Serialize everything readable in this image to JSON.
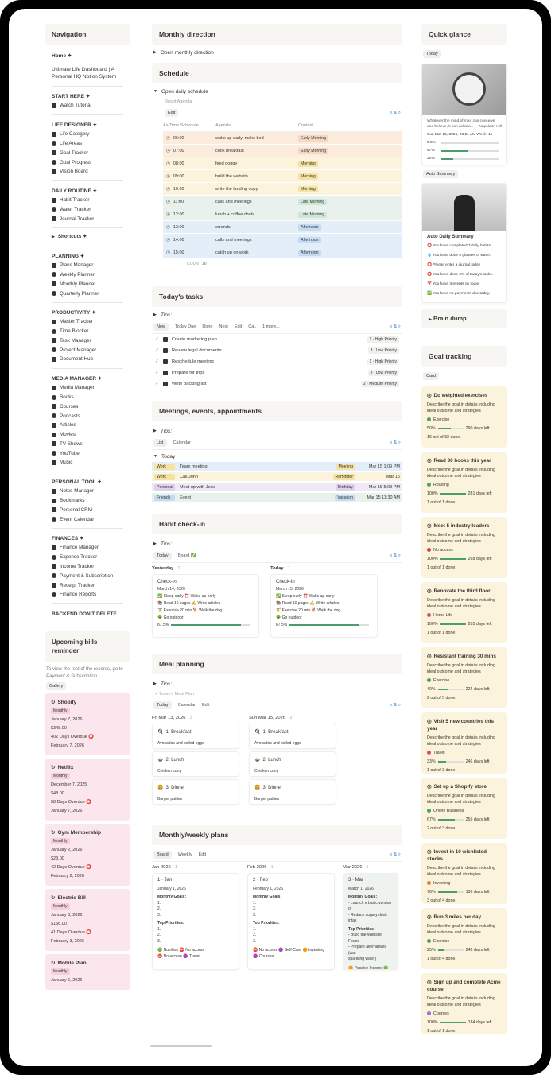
{
  "navigation": {
    "title": "Navigation",
    "home": "Home ✦",
    "home_link": "Ultimate Life Dashboard | A Personal HQ Notion System",
    "sections": [
      {
        "title": "START HERE ✦",
        "items": [
          "Watch Tutorial"
        ]
      },
      {
        "title": "LIFE DESIGNER ✦",
        "items": [
          "Life Category",
          "Life Areas",
          "Goal Tracker",
          "Goal Progress",
          "Vision Board"
        ]
      },
      {
        "title": "DAILY ROUTINE ✦",
        "items": [
          "Habit Tracker",
          "Water Tracker",
          "Journal Tracker"
        ]
      },
      {
        "title": "PLANNING ✦",
        "items": [
          "Plans Manager",
          "Weekly Planner",
          "Monthly Planner",
          "Quarterly Planner"
        ]
      },
      {
        "title": "PRODUCTIVITY ✦",
        "items": [
          "Master Tracker",
          "Time Blocker",
          "Task Manager",
          "Project Manager",
          "Document Hub"
        ]
      },
      {
        "title": "MEDIA MANAGER ✦",
        "items": [
          "Media Manager",
          "Books",
          "Courses",
          "Podcasts",
          "Articles",
          "Movies",
          "TV Shows",
          "YouTube",
          "Music"
        ]
      },
      {
        "title": "PERSONAL TOOL ✦",
        "items": [
          "Notes Manager",
          "Bookmarks",
          "Personal CRM",
          "Event Calendar"
        ]
      },
      {
        "title": "FINANCES ✦",
        "items": [
          "Finance Manager",
          "Expense Tracker",
          "Income Tracker",
          "Payment & Subscription",
          "Receipt Tracker",
          "Finance Reports"
        ]
      }
    ],
    "shortcuts": "Shortcuts ✦",
    "backend": "BACKEND DON'T DELETE"
  },
  "bills": {
    "title": "Upcoming bills reminder",
    "hint": "To view the rest of the records, go to",
    "hint_link": "Payment & Subscription",
    "view": "Gallery",
    "items": [
      {
        "name": "Shopify",
        "freq": "Monthly",
        "date": "January 7, 2026",
        "amount": "$348.00",
        "overdue": "402 Days Overdue ⭕",
        "next": "February 7, 2026"
      },
      {
        "name": "Netflix",
        "freq": "Monthly",
        "date": "December 7, 2025",
        "amount": "$48.00",
        "overdue": "58 Days Overdue ⭕",
        "next": "January 7, 2026"
      },
      {
        "name": "Gym Membership",
        "freq": "Monthly",
        "date": "January 2, 2026",
        "amount": "$23.00",
        "overdue": "42 Days Overdue ⭕",
        "next": "February 2, 2026"
      },
      {
        "name": "Electric Bill",
        "freq": "Monthly",
        "date": "January 3, 2026",
        "amount": "$156.00",
        "overdue": "41 Days Overdue ⭕",
        "next": "February 3, 2026"
      },
      {
        "name": "Mobile Plan",
        "freq": "Monthly",
        "date": "January 6, 2026",
        "amount": "",
        "overdue": "",
        "next": ""
      }
    ]
  },
  "monthly": {
    "title": "Monthly direction",
    "toggle": "Open monthly direction"
  },
  "schedule": {
    "title": "Schedule",
    "toggle": "Open daily schedule",
    "reset": "Reset Agenda",
    "edit": "Edit",
    "cols": [
      "Aa Time Schedule",
      "Agenda",
      "Context"
    ],
    "rows": [
      {
        "time": "06:00",
        "agenda": "wake up early, make bed",
        "ctx": "Early Morning",
        "bg": "#fbecdd",
        "tag": "#f3d9c4"
      },
      {
        "time": "07:00",
        "agenda": "cook breakfast",
        "ctx": "Early Morning",
        "bg": "#fbecdd",
        "tag": "#f3d9c4"
      },
      {
        "time": "08:00",
        "agenda": "feed doggy",
        "ctx": "Morning",
        "bg": "#fbf3db",
        "tag": "#f5e3a4"
      },
      {
        "time": "09:00",
        "agenda": "build the website",
        "ctx": "Morning",
        "bg": "#fbf3db",
        "tag": "#f5e3a4"
      },
      {
        "time": "10:00",
        "agenda": "write the landing copy",
        "ctx": "Morning",
        "bg": "#fbf3db",
        "tag": "#f5e3a4"
      },
      {
        "time": "11:00",
        "agenda": "calls and meetings",
        "ctx": "Late Morning",
        "bg": "#e8f1ec",
        "tag": "#cde6d6"
      },
      {
        "time": "12:00",
        "agenda": "lunch + coffee chats",
        "ctx": "Late Morning",
        "bg": "#e8f1ec",
        "tag": "#cde6d6"
      },
      {
        "time": "13:00",
        "agenda": "errands",
        "ctx": "Afternoon",
        "bg": "#e3eef9",
        "tag": "#c4dcf3"
      },
      {
        "time": "14:00",
        "agenda": "calls and meetings",
        "ctx": "Afternoon",
        "bg": "#e3eef9",
        "tag": "#c4dcf3"
      },
      {
        "time": "15:00",
        "agenda": "catch up on work",
        "ctx": "Afternoon",
        "bg": "#e3eef9",
        "tag": "#c4dcf3"
      }
    ],
    "count_label": "COUNT",
    "count": "10"
  },
  "tasks": {
    "title": "Today's tasks",
    "tips": "Tips:",
    "views": [
      "New",
      "Today Due",
      "Done",
      "Next",
      "Edit",
      "Cal.",
      "1 more..."
    ],
    "items": [
      {
        "name": "Create marketing plan",
        "pri": "1 · High Priority"
      },
      {
        "name": "Review legal documents",
        "pri": "3 · Low Priority"
      },
      {
        "name": "Reschedule meeting",
        "pri": "1 · High Priority"
      },
      {
        "name": "Prepare for trips",
        "pri": "3 · Low Priority"
      },
      {
        "name": "Write packing list",
        "pri": "2 · Medium Priority"
      }
    ]
  },
  "meetings": {
    "title": "Meetings, events, appointments",
    "tips": "Tips:",
    "views": [
      "List",
      "Calendar"
    ],
    "group": "Today",
    "items": [
      {
        "cat": "Work",
        "name": "Team meeting",
        "type": "Meeting",
        "date": "Mar 15 1:09 PM",
        "bg": "#e3eef9",
        "tag": "#f5e3a4"
      },
      {
        "cat": "Work",
        "name": "Call John",
        "type": "Reminder",
        "date": "Mar 15",
        "bg": "#fbf3db",
        "tag": "#f5e3a4"
      },
      {
        "cat": "Personal",
        "name": "Meet up with Jess",
        "type": "Birthday",
        "date": "Mar 15 5:03 PM",
        "bg": "#efe8f6",
        "tag": "#dfd0ee"
      },
      {
        "cat": "Friends",
        "name": "Event",
        "type": "Vacation",
        "date": "Mar 15 11:30 AM",
        "bg": "#e8f1ec",
        "tag": "#c4dcf3"
      }
    ]
  },
  "habit": {
    "title": "Habit check-in",
    "tips": "Tips:",
    "views": [
      "Today",
      "Board ✅"
    ],
    "groups": [
      {
        "label": "Yesterday",
        "count": "1",
        "card": "Check-in",
        "date": "March 14, 2026",
        "l1": "✅ Sleep early  ⏰ Wake up early",
        "l2": "📚 Read 10 pages  ✍ Write articles",
        "l3": "🏋 Exercise 20 min  🐕 Walk the dog",
        "l4": "🌳 Go outdoor",
        "pct": "87.5%",
        "val": 0.875
      },
      {
        "label": "Today",
        "count": "1",
        "card": "Check-in",
        "date": "March 15, 2026",
        "l1": "✅ Sleep early  ⏰ Wake up early",
        "l2": "📚 Read 10 pages  ✍ Write articles",
        "l3": "🏋 Exercise 20 min  🐕 Walk the dog",
        "l4": "🌳 Go outdoor",
        "pct": "87.5%",
        "val": 0.875
      }
    ]
  },
  "meal": {
    "title": "Meal planning",
    "tips": "Tips:",
    "new": "+ Today's Meal Plan",
    "views": [
      "Today",
      "Calendar",
      "Edit"
    ],
    "days": [
      {
        "label": "Fri Mar 13, 2026",
        "count": "3",
        "meals": [
          {
            "n": "1. Breakfast",
            "d": "Avocados and boiled eggs"
          },
          {
            "n": "2. Lunch",
            "d": "Chicken curry"
          },
          {
            "n": "3. Dinner",
            "d": "Burger patties"
          }
        ]
      },
      {
        "label": "Sun Mar 15, 2026",
        "count": "3",
        "meals": [
          {
            "n": "1. Breakfast",
            "d": "Avocados and boiled eggs"
          },
          {
            "n": "2. Lunch",
            "d": "Chicken curry"
          },
          {
            "n": "3. Dinner",
            "d": "Burger patties"
          }
        ]
      }
    ]
  },
  "plans": {
    "title": "Monthly/weekly plans",
    "views": [
      "Board",
      "Weekly",
      "Edit"
    ],
    "cols": [
      {
        "label": "Jan 2026",
        "count": "1",
        "name": "1 · Jan",
        "date": "January 1, 2026",
        "goals": "Monthly Goals:",
        "g": [
          "1.",
          "2.",
          "3."
        ],
        "prio": "Top Priorities:",
        "p": [
          "1.",
          "2.",
          "3."
        ],
        "tags": "🟢 Nutrition  ⛔ No access",
        "tags2": "⛔ No access  🟣 Travel"
      },
      {
        "label": "Feb 2026",
        "count": "1",
        "name": "2 · Feb",
        "date": "February 1, 2026",
        "goals": "Monthly Goals:",
        "g": [
          "1.",
          "2.",
          "3."
        ],
        "prio": "Top Priorities:",
        "p": [
          "1.",
          "2.",
          "3."
        ],
        "tags": "⛔ No access  🟣 Self-Care  🟠 Investing",
        "tags2": "🟣 Courses"
      },
      {
        "label": "Mar 2026",
        "count": "1",
        "name": "3 · Mar",
        "date": "March 1, 2026",
        "goals": "Monthly Goals:",
        "g": [
          "- Launch a basic version of",
          "- Reduce sugary drink intak"
        ],
        "prio": "Top Priorities:",
        "p": [
          "- Build the Website Found",
          "- Prepare alternatives (wat",
          "  sparkling water)"
        ],
        "tags": "🟠 Passive Income  🟢 Self",
        "tags2": ""
      }
    ]
  },
  "glance": {
    "title": "Quick glance",
    "view": "Today",
    "quote": "Whatever the mind of man can conceive and believe, it can achieve. — Napoleon Hill",
    "stamp": "Sun Mar 15, 2026, 08:21 AM Week: 11",
    "bars": [
      {
        "p": "0.0%",
        "v": 0
      },
      {
        "p": "47%",
        "v": 0.47
      },
      {
        "p": "20%",
        "v": 0.2
      }
    ],
    "auto": "Auto Summary",
    "summary_title": "Auto Daily Summary",
    "summary": [
      "⭕ You have completed 7 daily habits.",
      "💧 You have done 8 glasses of water.",
      "⭕ Please enter a journal today",
      "⭕ You have done 0% of today's tasks.",
      "📅 You have 3 events on today",
      "✅ You have no payments due today."
    ],
    "brain": "Brain dump"
  },
  "goals": {
    "title": "Goal tracking",
    "view": "Card",
    "desc": "Describe the goal in details including ideal outcome and strategies",
    "items": [
      {
        "t": "Do weighted exercises",
        "area": "Exercise",
        "c": "#4b9e6a",
        "pct": "50%",
        "v": 0.5,
        "left": "290 days left",
        "done": "16 out of 32 done."
      },
      {
        "t": "Read 30 books this year",
        "area": "Reading",
        "c": "#4b9e6a",
        "pct": "100%",
        "v": 1,
        "left": "281 days left",
        "done": "1 out of 1 done."
      },
      {
        "t": "Meet 5 industry leaders",
        "area": "No access",
        "c": "#c44",
        "pct": "100%",
        "v": 1,
        "left": "268 days left",
        "done": "1 out of 1 done."
      },
      {
        "t": "Renovate the third floor",
        "area": "Home Life",
        "c": "#d44c7a",
        "pct": "100%",
        "v": 1,
        "left": "255 days left",
        "done": "1 out of 1 done."
      },
      {
        "t": "Resistant training 30 mins",
        "area": "Exercise",
        "c": "#4b9e6a",
        "pct": "40%",
        "v": 0.4,
        "left": "224 days left",
        "done": "2 out of 5 done."
      },
      {
        "t": "Visit 5 new countries this year",
        "area": "Travel",
        "c": "#d44c7a",
        "pct": "33%",
        "v": 0.33,
        "left": "246 days left",
        "done": "1 out of 3 done."
      },
      {
        "t": "Set up a Shopify store",
        "area": "Online Business",
        "c": "#4b9e6a",
        "pct": "67%",
        "v": 0.67,
        "left": "255 days left",
        "done": "2 out of 3 done."
      },
      {
        "t": "Invest in 10 wishlisted stocks",
        "area": "Investing",
        "c": "#d9822b",
        "pct": "76%",
        "v": 0.76,
        "left": "136 days left",
        "done": "3 out of 4 done."
      },
      {
        "t": "Run 3 miles per day",
        "area": "Exercise",
        "c": "#4b9e6a",
        "pct": "25%",
        "v": 0.25,
        "left": "243 days left",
        "done": "1 out of 4 done."
      },
      {
        "t": "Sign up and complete Acme course",
        "area": "Courses",
        "c": "#9a6dd7",
        "pct": "100%",
        "v": 1,
        "left": "184 days left",
        "done": "1 out of 1 done."
      }
    ]
  }
}
